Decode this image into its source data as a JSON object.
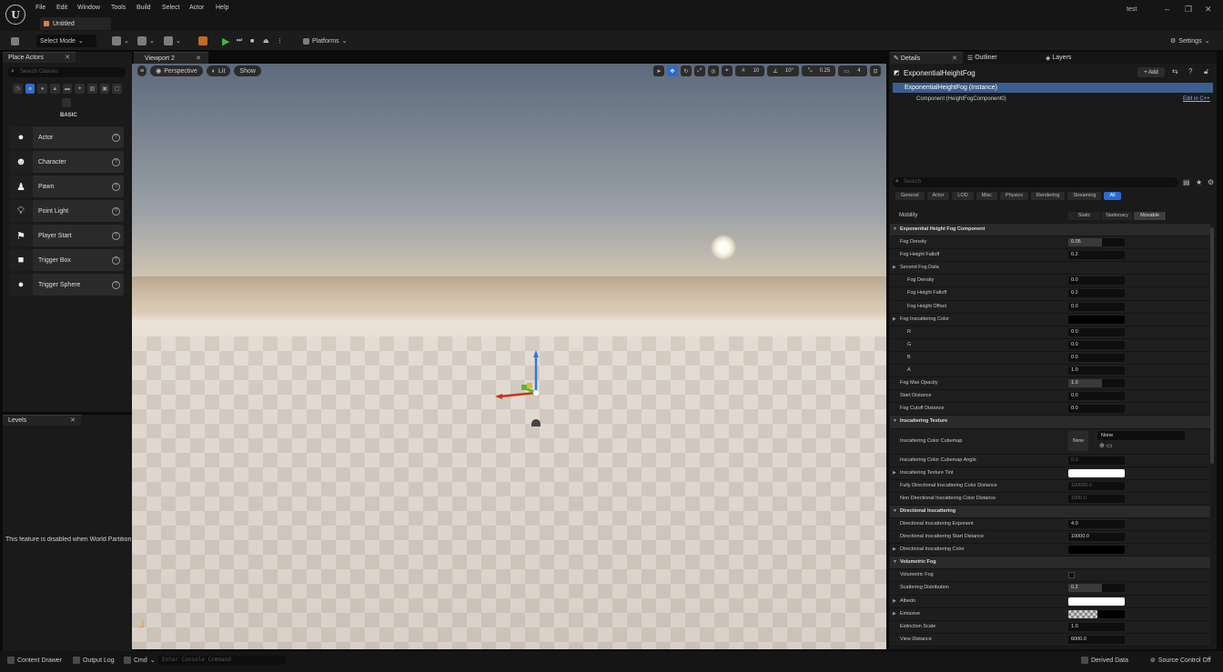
{
  "menu": [
    "File",
    "Edit",
    "Window",
    "Tools",
    "Build",
    "Select",
    "Actor",
    "Help"
  ],
  "document_tab": "Untitled",
  "user": "test",
  "toolbar": {
    "select_mode": "Select Mode",
    "platforms": "Platforms",
    "settings": "Settings"
  },
  "place_actors": {
    "tab": "Place Actors",
    "search_placeholder": "Search Classes",
    "category": "BASIC",
    "items": [
      {
        "label": "Actor",
        "icon": "sphere-icon"
      },
      {
        "label": "Character",
        "icon": "character-icon"
      },
      {
        "label": "Pawn",
        "icon": "pawn-icon"
      },
      {
        "label": "Point Light",
        "icon": "lightbulb-icon"
      },
      {
        "label": "Player Start",
        "icon": "flag-icon"
      },
      {
        "label": "Trigger Box",
        "icon": "box-icon"
      },
      {
        "label": "Trigger Sphere",
        "icon": "sphere-icon"
      }
    ]
  },
  "levels": {
    "tab": "Levels",
    "message": "This feature is disabled when World Partition i"
  },
  "viewport": {
    "tab": "Viewport 2",
    "perspective": "Perspective",
    "lit": "Lit",
    "show": "Show",
    "grid_snap": "10",
    "rotation_snap": "10°",
    "scale_snap": "0.25",
    "camera_speed": "4"
  },
  "details": {
    "tabs": [
      "Details",
      "Outliner",
      "Layers"
    ],
    "actor_name": "ExponentialHeightFog",
    "add_label": "+ Add",
    "instance": "ExponentialHeightFog (Instance)",
    "component": "Component (HeightFogComponent0)",
    "edit_cpp": "Edit in C++",
    "search_placeholder": "Search",
    "filters": [
      "General",
      "Actor",
      "LOD",
      "Misc",
      "Physics",
      "Rendering",
      "Streaming",
      "All"
    ],
    "active_filter": "All",
    "mobility_label": "Mobility",
    "mobility_options": [
      "Static",
      "Stationary",
      "Movable"
    ],
    "mobility_selected": "Movable",
    "rows": [
      {
        "name": "Exponential Height Fog Component",
        "section": true,
        "indent": 0
      },
      {
        "name": "Fog Density",
        "value": "0.05",
        "indent": 1,
        "bar": true
      },
      {
        "name": "Fog Height Falloff",
        "value": "0.2",
        "indent": 1
      },
      {
        "name": "Second Fog Data",
        "indent": 1,
        "group": true
      },
      {
        "name": "Fog Density",
        "value": "0.0",
        "indent": 2
      },
      {
        "name": "Fog Height Falloff",
        "value": "0.2",
        "indent": 2
      },
      {
        "name": "Fog Height Offset",
        "value": "0.0",
        "indent": 2
      },
      {
        "name": "Fog Inscattering Color",
        "indent": 1,
        "group": true,
        "swatch": "#000000"
      },
      {
        "name": "R",
        "value": "0.0",
        "indent": 2
      },
      {
        "name": "G",
        "value": "0.0",
        "indent": 2
      },
      {
        "name": "B",
        "value": "0.0",
        "indent": 2
      },
      {
        "name": "A",
        "value": "1.0",
        "indent": 2
      },
      {
        "name": "Fog Max Opacity",
        "value": "1.0",
        "indent": 1,
        "bar": true
      },
      {
        "name": "Start Distance",
        "value": "0.0",
        "indent": 1
      },
      {
        "name": "Fog Cutoff Distance",
        "value": "0.0",
        "indent": 1
      },
      {
        "name": "Inscattering Texture",
        "section": true,
        "indent": 0
      },
      {
        "name": "Inscattering Color Cubemap",
        "indent": 1,
        "cubemap": true
      },
      {
        "name": "Inscattering Color Cubemap Angle",
        "value": "0.0",
        "indent": 1,
        "dim": true
      },
      {
        "name": "Inscattering Texture Tint",
        "indent": 1,
        "group": true,
        "swatch": "#ffffff"
      },
      {
        "name": "Fully Directional Inscattering Color Distance",
        "value": "100000.0",
        "indent": 1,
        "dim": true
      },
      {
        "name": "Non Directional Inscattering Color Distance",
        "value": "1000.0",
        "indent": 1,
        "dim": true
      },
      {
        "name": "Directional Inscattering",
        "section": true,
        "indent": 0
      },
      {
        "name": "Directional Inscattering Exponent",
        "value": "4.0",
        "indent": 1
      },
      {
        "name": "Directional Inscattering Start Distance",
        "value": "10000.0",
        "indent": 1
      },
      {
        "name": "Directional Inscattering Color",
        "indent": 1,
        "group": true,
        "swatch": "#000000"
      },
      {
        "name": "Volumetric Fog",
        "section": true,
        "indent": 0
      },
      {
        "name": "Volumetric Fog",
        "indent": 1,
        "checkbox": true
      },
      {
        "name": "Scattering Distribution",
        "value": "0.2",
        "indent": 1,
        "bar": true
      },
      {
        "name": "Albedo",
        "indent": 1,
        "group": true,
        "swatch": "#ffffff"
      },
      {
        "name": "Emissive",
        "indent": 1,
        "group": true,
        "swatch": "checker"
      },
      {
        "name": "Extinction Scale",
        "value": "1.0",
        "indent": 1
      },
      {
        "name": "View Distance",
        "value": "6000.0",
        "indent": 1
      }
    ],
    "cubemap_thumb": "None",
    "cubemap_select": "None"
  },
  "statusbar": {
    "content_drawer": "Content Drawer",
    "output_log": "Output Log",
    "cmd": "Cmd",
    "cmd_placeholder": "Enter Console Command",
    "derived_data": "Derived Data",
    "source_control": "Source Control Off"
  }
}
